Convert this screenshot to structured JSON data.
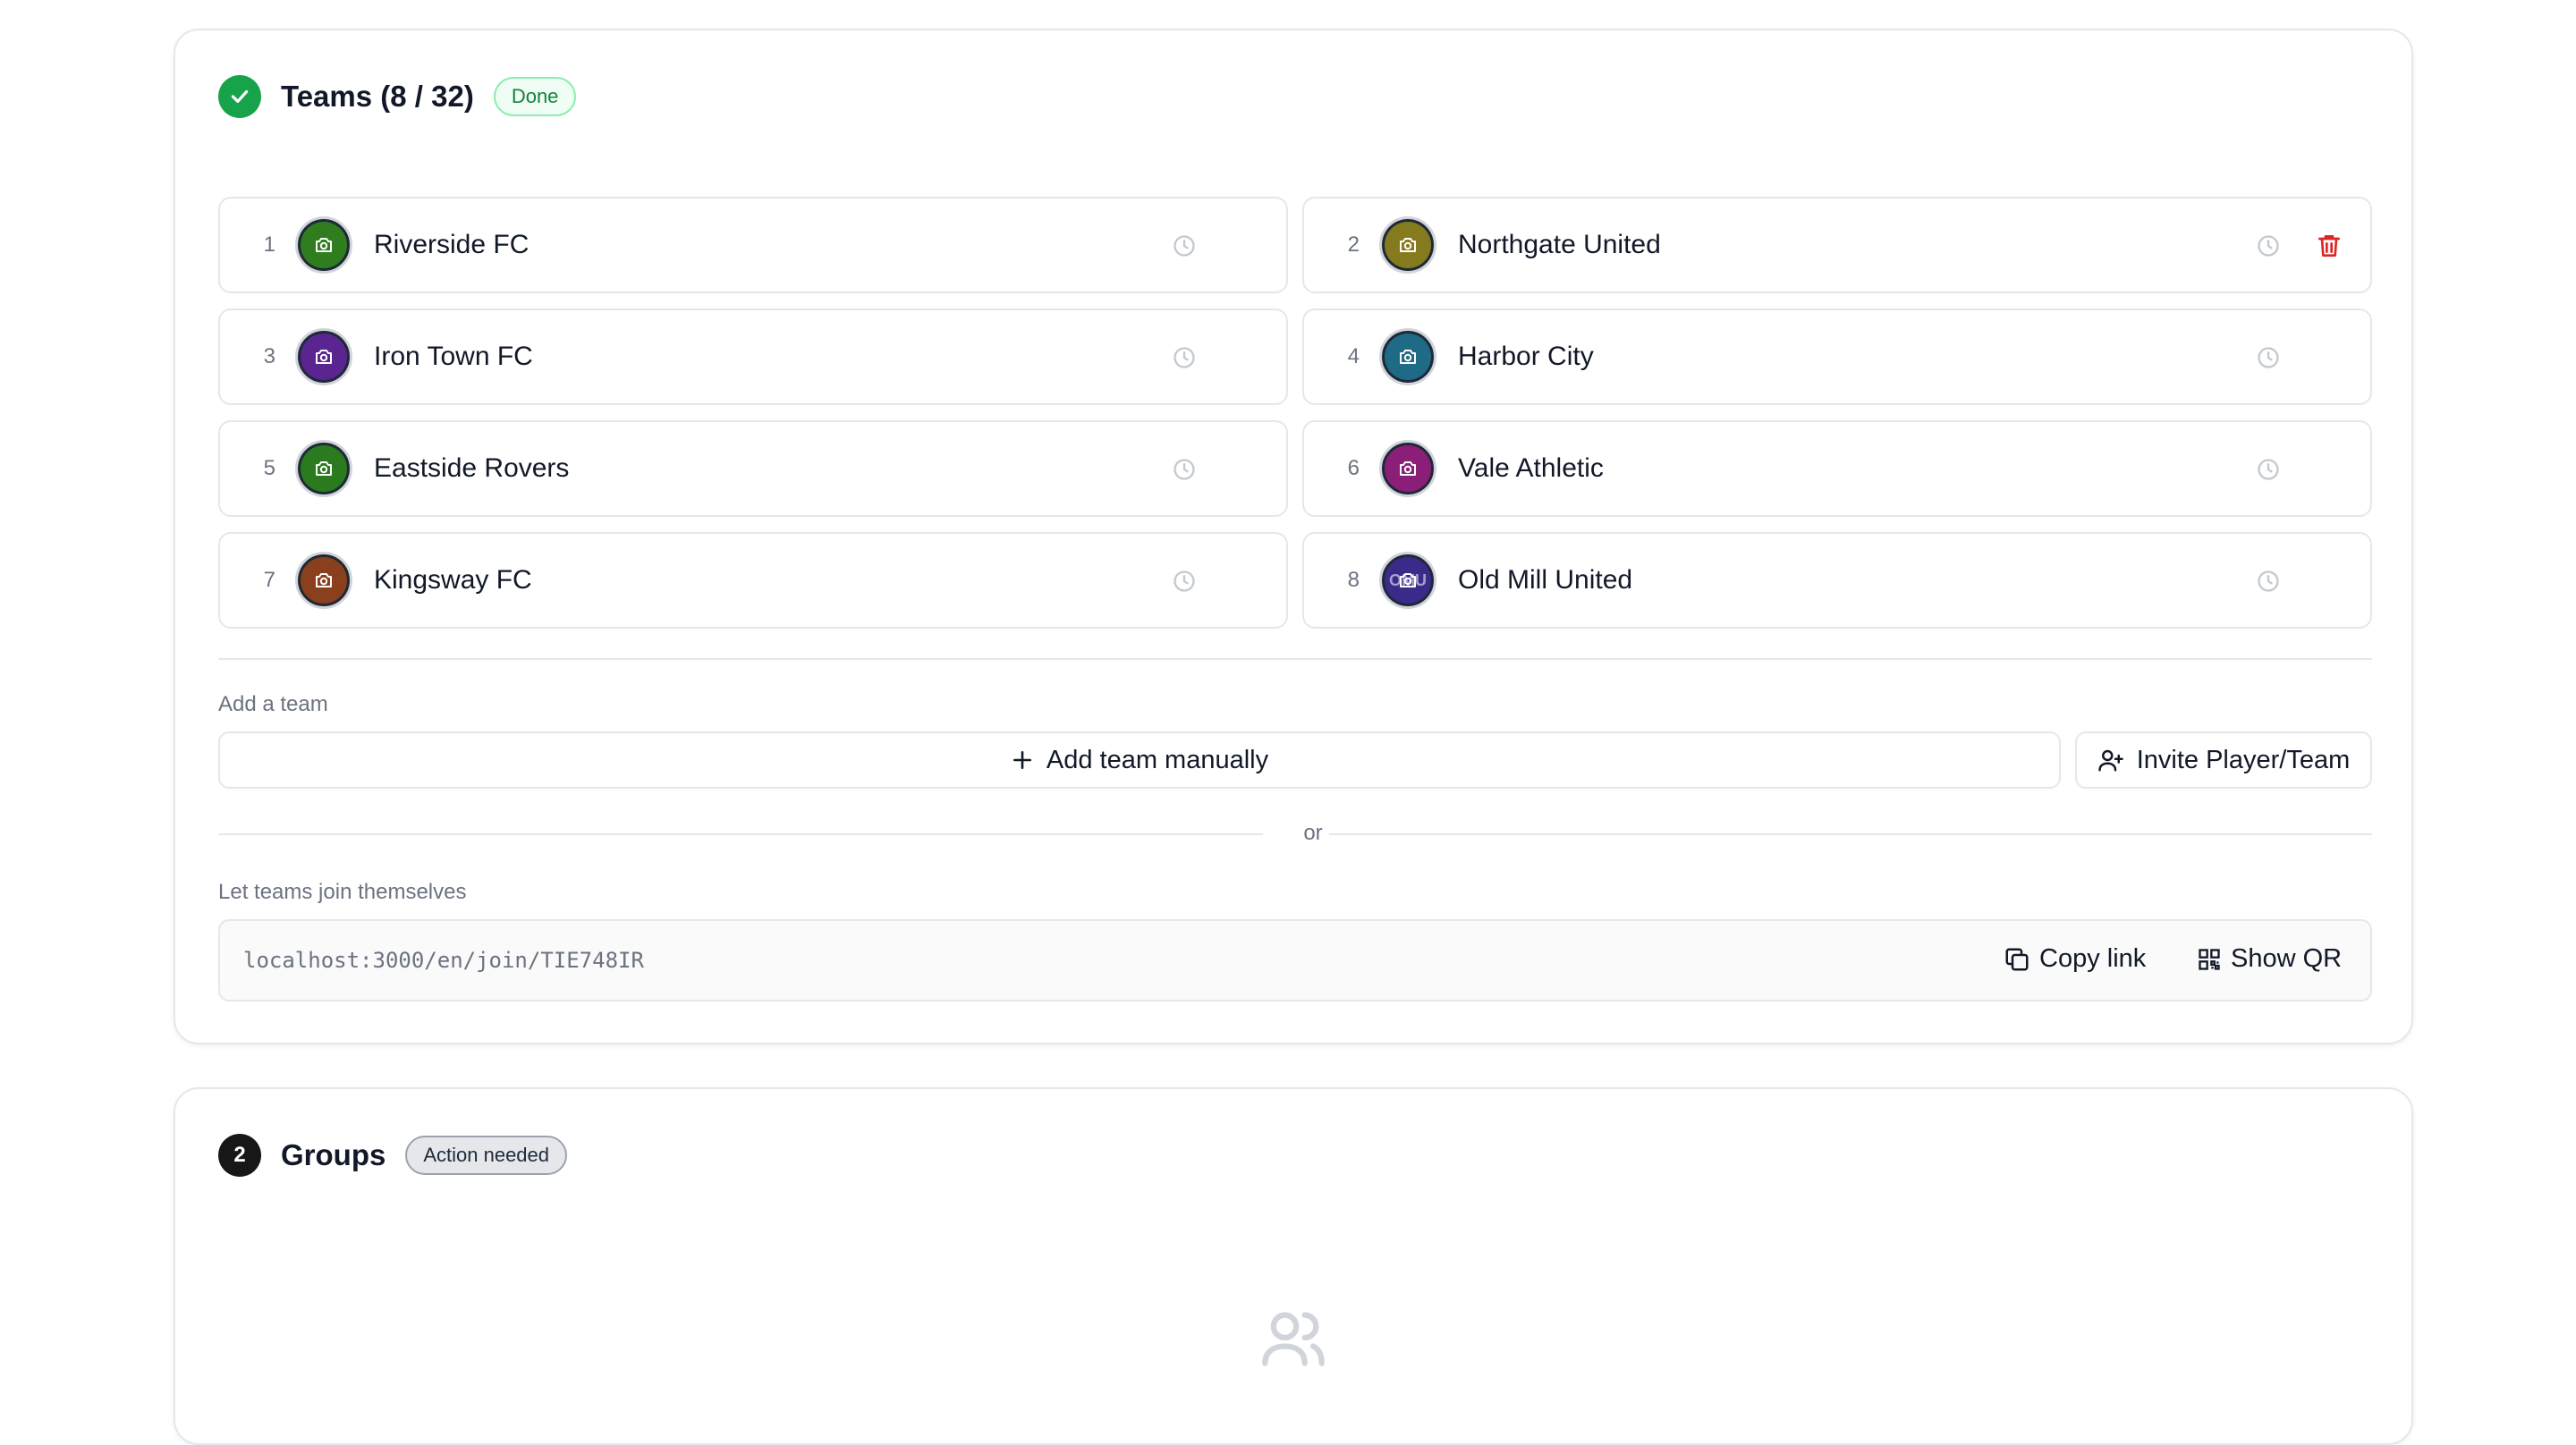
{
  "teams_step": {
    "title": "Teams (8 / 32)",
    "badge": "Done",
    "teams": [
      {
        "index": "1",
        "name": "Riverside FC",
        "color": "#2f7d1f"
      },
      {
        "index": "2",
        "name": "Northgate United",
        "color": "#857a1e"
      },
      {
        "index": "3",
        "name": "Iron Town FC",
        "color": "#5b2591"
      },
      {
        "index": "4",
        "name": "Harbor City",
        "color": "#1f6a86"
      },
      {
        "index": "5",
        "name": "Eastside Rovers",
        "color": "#2a7a1e"
      },
      {
        "index": "6",
        "name": "Vale Athletic",
        "color": "#8b1f78"
      },
      {
        "index": "7",
        "name": "Kingsway FC",
        "color": "#8a3f1d"
      },
      {
        "index": "8",
        "name": "Old Mill United",
        "color": "#3b2a8a",
        "initials": "OMU"
      }
    ],
    "add_team_label": "Add a team",
    "add_manually_button": "Add team manually",
    "invite_button": "Invite Player/Team",
    "or_text": "or",
    "self_join_label": "Let teams join themselves",
    "join_link": "localhost:3000/en/join/TIE748IR",
    "copy_link_button": "Copy link",
    "show_qr_button": "Show QR"
  },
  "groups_step": {
    "number": "2",
    "title": "Groups",
    "badge": "Action needed"
  },
  "colors": {
    "done_green": "#16a34a",
    "delete_red": "#dc2626",
    "border": "#e5e7eb"
  },
  "icons": [
    "check-icon",
    "camera-icon",
    "clock-icon",
    "trash-icon",
    "plus-icon",
    "user-plus-icon",
    "copy-icon",
    "qr-code-icon",
    "users-icon"
  ]
}
